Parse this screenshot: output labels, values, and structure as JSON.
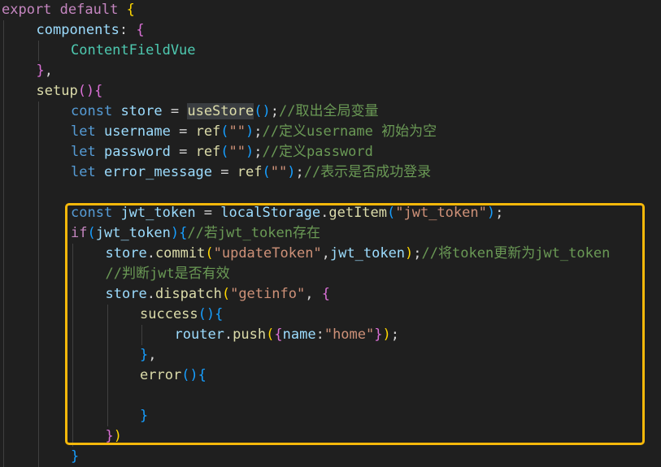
{
  "colors": {
    "background": "#1f1f1f",
    "keyword": "#569cd6",
    "control": "#c586c0",
    "variable": "#9cdcfe",
    "property": "#9cdcfe",
    "function": "#dcdcaa",
    "string": "#ce9178",
    "comment": "#6a9955",
    "component": "#4ec9b0",
    "punct": "#d4d4d4",
    "brace1": "#ffd700",
    "brace2": "#da70d6",
    "brace3": "#179fff",
    "highlight_border": "#f6b80a",
    "indent_guide": "#404040"
  },
  "lines": [
    {
      "indent": 0,
      "tokens": [
        {
          "t": "export",
          "c": "control"
        },
        {
          "t": " ",
          "c": "punct"
        },
        {
          "t": "default",
          "c": "control"
        },
        {
          "t": " ",
          "c": "punct"
        },
        {
          "t": "{",
          "c": "brace1"
        }
      ]
    },
    {
      "indent": 1,
      "tokens": [
        {
          "t": "components",
          "c": "property"
        },
        {
          "t": ": ",
          "c": "punct"
        },
        {
          "t": "{",
          "c": "brace2"
        }
      ]
    },
    {
      "indent": 2,
      "tokens": [
        {
          "t": "ContentFieldVue",
          "c": "component"
        }
      ]
    },
    {
      "indent": 1,
      "tokens": [
        {
          "t": "}",
          "c": "brace2"
        },
        {
          "t": ",",
          "c": "punct"
        }
      ]
    },
    {
      "indent": 1,
      "tokens": [
        {
          "t": "setup",
          "c": "function"
        },
        {
          "t": "()",
          "c": "brace2"
        },
        {
          "t": "{",
          "c": "brace2"
        }
      ]
    },
    {
      "indent": 2,
      "tokens": [
        {
          "t": "const",
          "c": "keyword"
        },
        {
          "t": " ",
          "c": "punct"
        },
        {
          "t": "store",
          "c": "variable"
        },
        {
          "t": " = ",
          "c": "punct"
        },
        {
          "t": "useStore",
          "c": "function",
          "hl": true
        },
        {
          "t": "()",
          "c": "brace3"
        },
        {
          "t": ";",
          "c": "punct"
        },
        {
          "t": "//取出全局变量",
          "c": "comment"
        }
      ]
    },
    {
      "indent": 2,
      "tokens": [
        {
          "t": "let",
          "c": "keyword"
        },
        {
          "t": " ",
          "c": "punct"
        },
        {
          "t": "username",
          "c": "variable"
        },
        {
          "t": " = ",
          "c": "punct"
        },
        {
          "t": "ref",
          "c": "function"
        },
        {
          "t": "(",
          "c": "brace3"
        },
        {
          "t": "\"\"",
          "c": "string"
        },
        {
          "t": ")",
          "c": "brace3"
        },
        {
          "t": ";",
          "c": "punct"
        },
        {
          "t": "//定义username 初始为空",
          "c": "comment"
        }
      ]
    },
    {
      "indent": 2,
      "tokens": [
        {
          "t": "let",
          "c": "keyword"
        },
        {
          "t": " ",
          "c": "punct"
        },
        {
          "t": "password",
          "c": "variable"
        },
        {
          "t": " = ",
          "c": "punct"
        },
        {
          "t": "ref",
          "c": "function"
        },
        {
          "t": "(",
          "c": "brace3"
        },
        {
          "t": "\"\"",
          "c": "string"
        },
        {
          "t": ")",
          "c": "brace3"
        },
        {
          "t": ";",
          "c": "punct"
        },
        {
          "t": "//定义password",
          "c": "comment"
        }
      ]
    },
    {
      "indent": 2,
      "tokens": [
        {
          "t": "let",
          "c": "keyword"
        },
        {
          "t": " ",
          "c": "punct"
        },
        {
          "t": "error_message",
          "c": "variable"
        },
        {
          "t": " = ",
          "c": "punct"
        },
        {
          "t": "ref",
          "c": "function"
        },
        {
          "t": "(",
          "c": "brace3"
        },
        {
          "t": "\"\"",
          "c": "string"
        },
        {
          "t": ")",
          "c": "brace3"
        },
        {
          "t": ";",
          "c": "punct"
        },
        {
          "t": "//表示是否成功登录",
          "c": "comment"
        }
      ]
    },
    {
      "indent": 2,
      "tokens": []
    },
    {
      "indent": 2,
      "tokens": [
        {
          "t": "const",
          "c": "keyword"
        },
        {
          "t": " ",
          "c": "punct"
        },
        {
          "t": "jwt_token",
          "c": "variable"
        },
        {
          "t": " = ",
          "c": "punct"
        },
        {
          "t": "localStorage",
          "c": "variable"
        },
        {
          "t": ".",
          "c": "punct"
        },
        {
          "t": "getItem",
          "c": "function"
        },
        {
          "t": "(",
          "c": "brace3"
        },
        {
          "t": "\"jwt_token\"",
          "c": "string"
        },
        {
          "t": ")",
          "c": "brace3"
        },
        {
          "t": ";",
          "c": "punct"
        }
      ]
    },
    {
      "indent": 2,
      "tokens": [
        {
          "t": "if",
          "c": "control"
        },
        {
          "t": "(",
          "c": "brace3"
        },
        {
          "t": "jwt_token",
          "c": "variable"
        },
        {
          "t": ")",
          "c": "brace3"
        },
        {
          "t": "{",
          "c": "brace3"
        },
        {
          "t": "//若jwt_token存在",
          "c": "comment"
        }
      ]
    },
    {
      "indent": 3,
      "tokens": [
        {
          "t": "store",
          "c": "variable"
        },
        {
          "t": ".",
          "c": "punct"
        },
        {
          "t": "commit",
          "c": "function"
        },
        {
          "t": "(",
          "c": "brace1"
        },
        {
          "t": "\"updateToken\"",
          "c": "string"
        },
        {
          "t": ",",
          "c": "punct"
        },
        {
          "t": "jwt_token",
          "c": "variable"
        },
        {
          "t": ")",
          "c": "brace1"
        },
        {
          "t": ";",
          "c": "punct"
        },
        {
          "t": "//将token更新为jwt_token",
          "c": "comment"
        }
      ]
    },
    {
      "indent": 3,
      "tokens": [
        {
          "t": "//判断jwt是否有效",
          "c": "comment"
        }
      ]
    },
    {
      "indent": 3,
      "tokens": [
        {
          "t": "store",
          "c": "variable"
        },
        {
          "t": ".",
          "c": "punct"
        },
        {
          "t": "dispatch",
          "c": "function"
        },
        {
          "t": "(",
          "c": "brace1"
        },
        {
          "t": "\"getinfo\"",
          "c": "string"
        },
        {
          "t": ", ",
          "c": "punct"
        },
        {
          "t": "{",
          "c": "brace2"
        }
      ]
    },
    {
      "indent": 4,
      "tokens": [
        {
          "t": "success",
          "c": "function"
        },
        {
          "t": "()",
          "c": "brace3"
        },
        {
          "t": "{",
          "c": "brace3"
        }
      ]
    },
    {
      "indent": 5,
      "tokens": [
        {
          "t": "router",
          "c": "variable"
        },
        {
          "t": ".",
          "c": "punct"
        },
        {
          "t": "push",
          "c": "function"
        },
        {
          "t": "(",
          "c": "brace1"
        },
        {
          "t": "{",
          "c": "brace2"
        },
        {
          "t": "name",
          "c": "property"
        },
        {
          "t": ":",
          "c": "punct"
        },
        {
          "t": "\"home\"",
          "c": "string"
        },
        {
          "t": "}",
          "c": "brace2"
        },
        {
          "t": ")",
          "c": "brace1"
        },
        {
          "t": ";",
          "c": "punct"
        }
      ]
    },
    {
      "indent": 4,
      "tokens": [
        {
          "t": "}",
          "c": "brace3"
        },
        {
          "t": ",",
          "c": "punct"
        }
      ]
    },
    {
      "indent": 4,
      "tokens": [
        {
          "t": "error",
          "c": "function"
        },
        {
          "t": "()",
          "c": "brace3"
        },
        {
          "t": "{",
          "c": "brace3"
        }
      ]
    },
    {
      "indent": 4,
      "tokens": []
    },
    {
      "indent": 4,
      "tokens": [
        {
          "t": "}",
          "c": "brace3"
        }
      ]
    },
    {
      "indent": 3,
      "tokens": [
        {
          "t": "}",
          "c": "brace2"
        },
        {
          "t": ")",
          "c": "brace1"
        }
      ]
    },
    {
      "indent": 2,
      "tokens": [
        {
          "t": "}",
          "c": "brace3"
        }
      ]
    }
  ]
}
